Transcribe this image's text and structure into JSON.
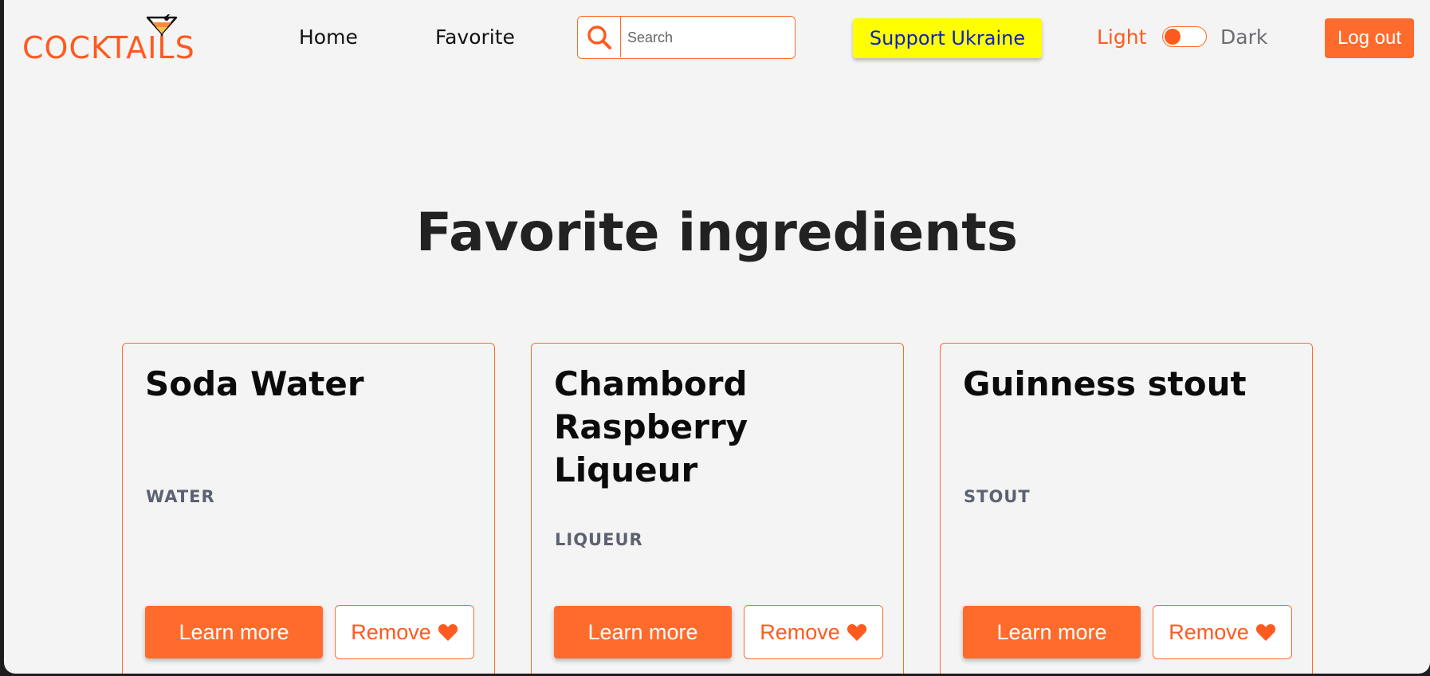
{
  "header": {
    "logo_text": "COCKTAILS",
    "nav": [
      {
        "label": "Home"
      },
      {
        "label": "Favorite"
      }
    ],
    "search": {
      "placeholder": "Search"
    },
    "support_label": "Support Ukraine",
    "theme": {
      "light_label": "Light",
      "dark_label": "Dark",
      "mode": "light"
    },
    "logout_label": "Log out"
  },
  "main": {
    "title": "Favorite ingredients",
    "cards": [
      {
        "name": "Soda Water",
        "type": "WATER",
        "learn_label": "Learn more",
        "remove_label": "Remove"
      },
      {
        "name": "Chambord Raspberry Liqueur",
        "type": "LIQUEUR",
        "learn_label": "Learn more",
        "remove_label": "Remove"
      },
      {
        "name": "Guinness stout",
        "type": "STOUT",
        "learn_label": "Learn more",
        "remove_label": "Remove"
      }
    ]
  },
  "colors": {
    "accent": "#ff6b2c",
    "support_bg": "#ffff00",
    "support_text": "#0b1fc8",
    "background": "#f4f4f4"
  },
  "icons": {
    "search": "search-icon",
    "heart": "heart-icon",
    "logo": "cocktail-glass-icon"
  }
}
